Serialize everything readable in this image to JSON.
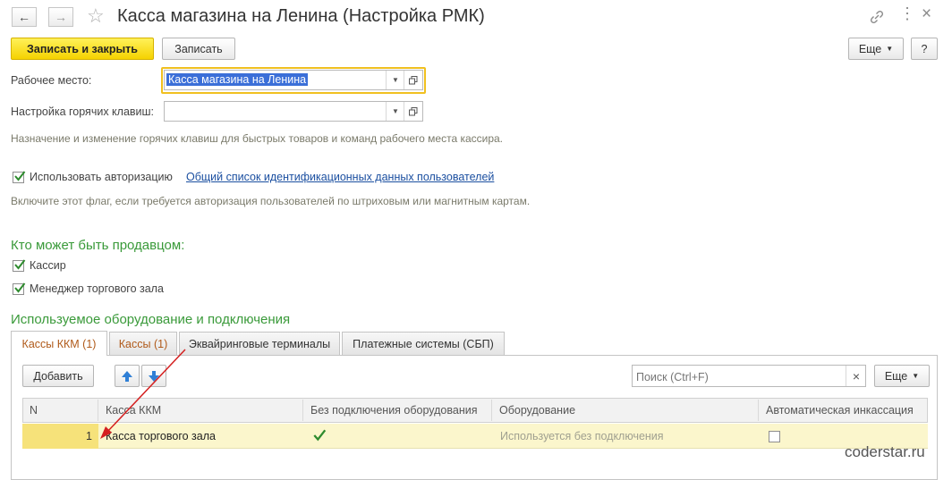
{
  "window": {
    "title": "Касса магазина на Ленина (Настройка РМК)"
  },
  "toolbar": {
    "save_close_label": "Записать и закрыть",
    "save_label": "Записать",
    "more_label": "Еще",
    "help_label": "?"
  },
  "form": {
    "workplace_label": "Рабочее место:",
    "workplace_value": "Касса магазина на Ленина",
    "hotkeys_label": "Настройка горячих клавиш:",
    "hotkeys_value": "",
    "hotkeys_hint": "Назначение и изменение горячих клавиш для быстрых товаров и команд рабочего места кассира.",
    "use_auth_label": "Использовать авторизацию",
    "use_auth_checked": true,
    "auth_link": "Общий список идентификационных данных пользователей",
    "auth_hint": "Включите этот флаг, если требуется авторизация пользователей по штриховым или магнитным картам."
  },
  "sellers": {
    "title": "Кто может быть продавцом:",
    "cashier_label": "Кассир",
    "cashier_checked": true,
    "manager_label": "Менеджер торгового зала",
    "manager_checked": true
  },
  "equipment": {
    "title": "Используемое оборудование и подключения",
    "tabs": [
      {
        "label": "Кассы ККМ (1)"
      },
      {
        "label": "Кассы (1)"
      },
      {
        "label": "Эквайринговые терминалы"
      },
      {
        "label": "Платежные системы (СБП)"
      }
    ],
    "add_label": "Добавить",
    "search_placeholder": "Поиск (Ctrl+F)",
    "clear_label": "×",
    "more_label": "Еще",
    "columns": [
      "N",
      "Касса ККМ",
      "Без подключения оборудования",
      "Оборудование",
      "Автоматическая инкассация"
    ],
    "rows": [
      {
        "n": "1",
        "kkm": "Касса торгового зала",
        "no_connection": true,
        "equipment": "Используется без подключения",
        "auto_collection": false
      }
    ]
  },
  "watermark": "coderstar.ru",
  "colors": {
    "primary_button": "#f5d200",
    "section_title": "#3a9a3a",
    "link": "#1b4fa0",
    "selected_row": "#fbf6cc",
    "active_tab_text": "#b05a1a",
    "field_focus_border": "#f0c020",
    "arrow": "#d42020"
  }
}
